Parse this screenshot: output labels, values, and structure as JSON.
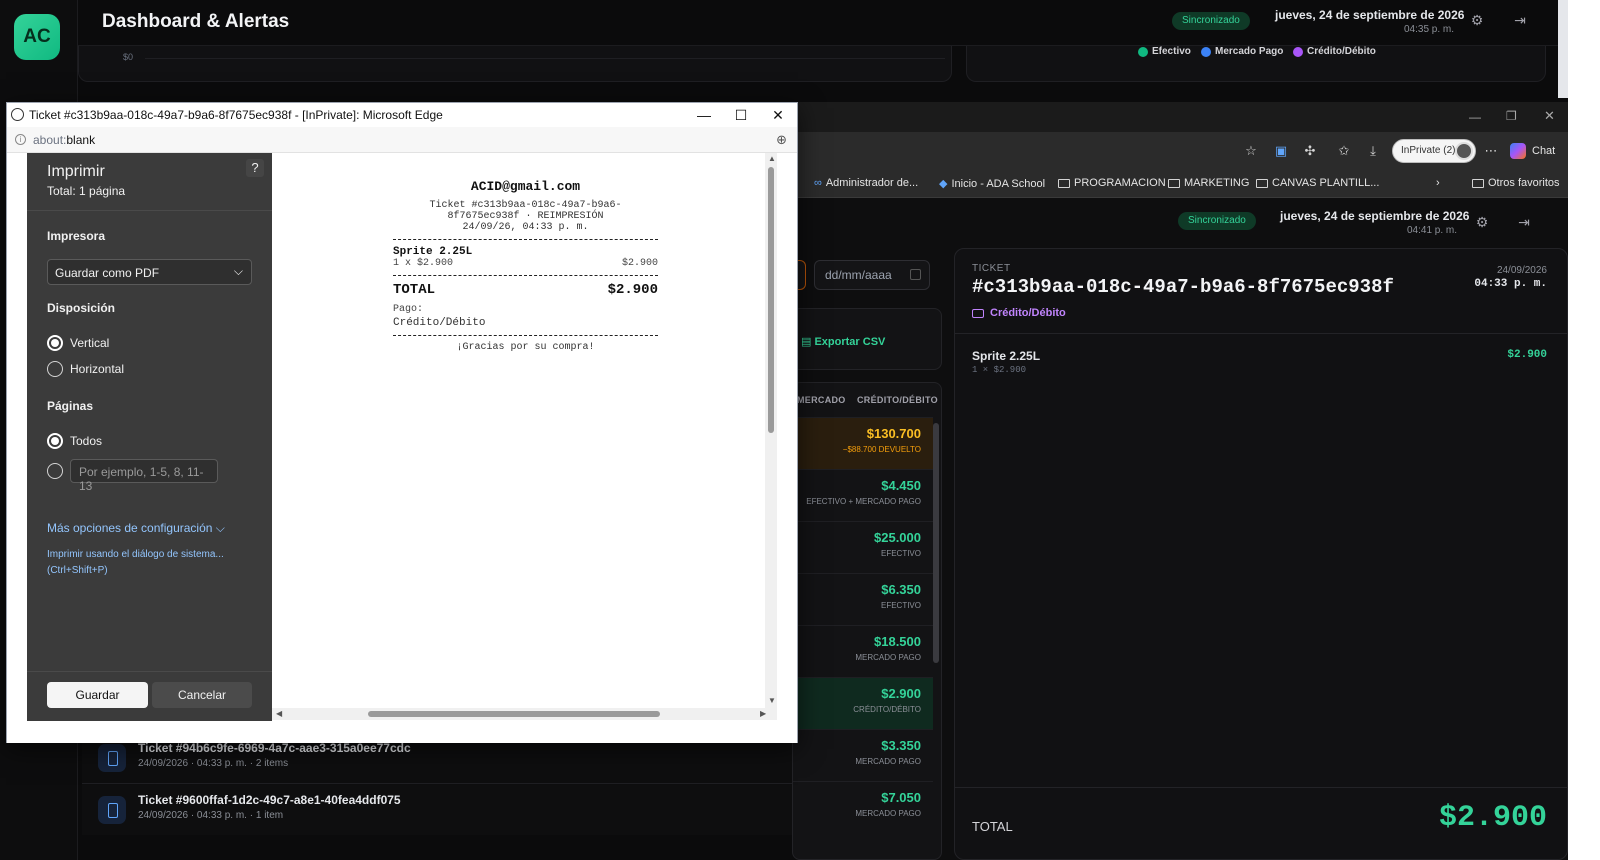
{
  "dashboard": {
    "logo": "AC",
    "title": "Dashboard & Alertas",
    "sync": "Sincronizado",
    "date": "jueves, 24 de septiembre de 2026",
    "time": "04:35 p. m.",
    "chart_axis_label": "$0",
    "legend": [
      {
        "label": "Efectivo",
        "color": "#10b981"
      },
      {
        "label": "Mercado Pago",
        "color": "#3b82f6"
      },
      {
        "label": "Crédito/Débito",
        "color": "#a855f7"
      }
    ]
  },
  "edge2": {
    "inprivate": "InPrivate (2)",
    "chat": "Chat",
    "bookmarks": [
      "Administrador de...",
      "Inicio - ADA School",
      "PROGRAMACION",
      "MARKETING",
      "CANVAS PLANTILL...",
      "Otros favoritos"
    ],
    "sync": "Sincronizado",
    "date": "jueves, 24 de septiembre de 2026",
    "time": "04:41 p. m.",
    "date_placeholder": "dd/mm/aaaa",
    "export_csv": "Exportar CSV",
    "col_mercado": "MERCADO",
    "col_credito": "CRÉDITO/DÉBITO",
    "rows": [
      {
        "amount": "$130.700",
        "sub": "−$88.700 DEVUELTO"
      },
      {
        "amount": "$4.450",
        "sub": "EFECTIVO + MERCADO PAGO"
      },
      {
        "amount": "$25.000",
        "sub": "EFECTIVO"
      },
      {
        "amount": "$6.350",
        "sub": "EFECTIVO"
      },
      {
        "amount": "$18.500",
        "sub": "MERCADO PAGO"
      },
      {
        "amount": "$2.900",
        "sub": "CRÉDITO/DÉBITO"
      }
    ],
    "ticket_rows": [
      {
        "title": "Ticket #94b6c9fe-6969-4a7c-aae3-315a0ee77cdc",
        "sub": "24/09/2026 · 04:33 p. m. · 2 items",
        "amount": "$3.350",
        "pay": "MERCADO PAGO"
      },
      {
        "title": "Ticket #9600ffaf-1d2c-49c7-a8e1-40fea4ddf075",
        "sub": "24/09/2026 · 04:33 p. m. · 1 item",
        "amount": "$7.050",
        "pay": "MERCADO PAGO"
      }
    ],
    "ticket": {
      "label": "TICKET",
      "id": "#c313b9aa-018c-49a7-b9a6-8f7675ec938f",
      "date": "24/09/2026",
      "time": "04:33 p. m.",
      "method": "Crédito/Débito",
      "item_name": "Sprite 2.25L",
      "item_qty": "1 × $2.900",
      "item_price": "$2.900",
      "total_label": "TOTAL",
      "total": "$2.900"
    }
  },
  "printwin": {
    "title": "Ticket #c313b9aa-018c-49a7-b9a6-8f7675ec938f - [InPrivate]: Microsoft Edge",
    "url_prefix": "about:",
    "url_rest": "blank",
    "panel": {
      "title": "Imprimir",
      "total": "Total: 1 página",
      "help": "?",
      "printer_label": "Impresora",
      "printer_value": "Guardar como PDF",
      "layout_label": "Disposición",
      "vertical": "Vertical",
      "horizontal": "Horizontal",
      "pages_label": "Páginas",
      "all": "Todos",
      "range_placeholder": "Por ejemplo, 1-5, 8, 11-13",
      "more": "Más opciones de configuración",
      "system_dialog": "Imprimir usando el diálogo de sistema...",
      "system_shortcut": "(Ctrl+Shift+P)",
      "save": "Guardar",
      "cancel": "Cancelar"
    },
    "receipt": {
      "email": "ACID@gmail.com",
      "line1": "Ticket #c313b9aa-018c-49a7-b9a6-",
      "line2": "8f7675ec938f · REIMPRESIÓN",
      "line3": "24/09/26, 04:33 p. m.",
      "item": "Sprite 2.25L",
      "qty": "1 x $2.900",
      "price": "$2.900",
      "total_label": "TOTAL",
      "total": "$2.900",
      "pay_label": "Pago:",
      "pay_value": "Crédito/Débito",
      "thanks": "¡Gracias por su compra!"
    }
  }
}
